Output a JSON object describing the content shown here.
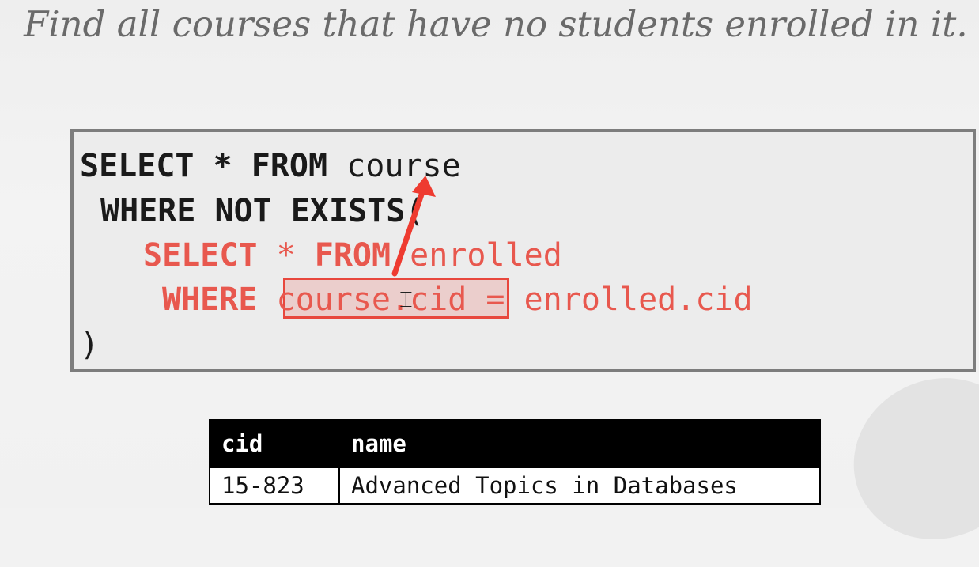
{
  "slide": {
    "title": "Find all courses that have no students enrolled in it."
  },
  "query": {
    "line1_kw1": "SELECT",
    "line1_op": " * ",
    "line1_kw2": "FROM",
    "line1_table": " course",
    "line2_kw": "WHERE NOT EXISTS",
    "line2_paren": "(",
    "line3_kw1": "SELECT",
    "line3_op": " * ",
    "line3_kw2": "FROM",
    "line3_table": " enrolled",
    "line4_kw": "WHERE ",
    "line4_lhs": "course.cid",
    "line4_rhs": " = enrolled.cid",
    "line5_paren": ")"
  },
  "result_table": {
    "headers": [
      "cid",
      "name"
    ],
    "rows": [
      [
        "15-823",
        "Advanced Topics in Databases"
      ]
    ]
  },
  "colors": {
    "highlight": "#e8473d",
    "inner_query": "#e8584e",
    "outer_query": "#1a1a1a"
  },
  "icons": {
    "cursor": "text-cursor-icon",
    "arrow": "reference-arrow-icon"
  }
}
